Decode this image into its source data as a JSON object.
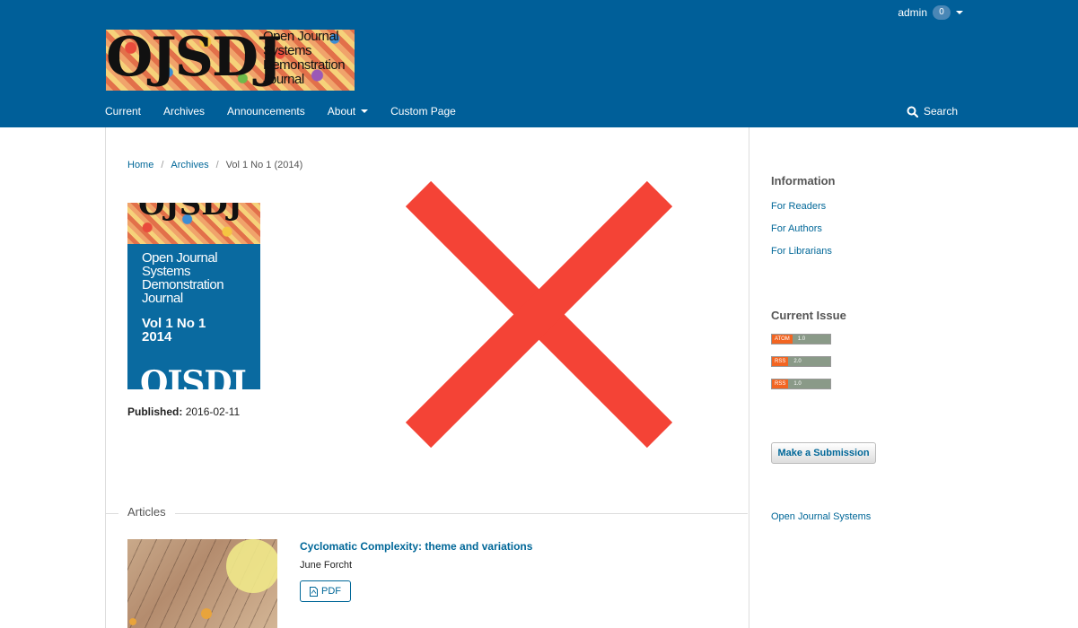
{
  "header": {
    "user": {
      "name": "admin",
      "notification_count": "0"
    },
    "logo": {
      "mark": "OJSDJ",
      "text_lines": [
        "Open Journal",
        "Systems",
        "Demonstration",
        "Journal"
      ]
    },
    "nav": {
      "items": [
        "Current",
        "Archives",
        "Announcements",
        "About",
        "Custom Page"
      ],
      "search_label": "Search"
    }
  },
  "breadcrumb": {
    "home": "Home",
    "archives": "Archives",
    "current": "Vol 1 No 1 (2014)"
  },
  "issue": {
    "cover": {
      "top_mark": "OJSDJ",
      "title_lines": [
        "Open Journal",
        "Systems",
        "Demonstration",
        "Journal"
      ],
      "vol_lines": [
        "Vol 1 No 1",
        "2014"
      ],
      "bottom_mark": "OJSDJ"
    },
    "published_label": "Published:",
    "published_date": "2016-02-11"
  },
  "articles": {
    "section_label": "Articles",
    "items": [
      {
        "title": "Cyclomatic Complexity: theme and variations",
        "author": "June Forcht",
        "galley_label": "PDF"
      }
    ]
  },
  "sidebar": {
    "information_heading": "Information",
    "information_links": [
      "For Readers",
      "For Authors",
      "For Librarians"
    ],
    "current_issue_heading": "Current Issue",
    "feeds": [
      {
        "type": "ATOM",
        "version": "1.0"
      },
      {
        "type": "RSS",
        "version": "2.0"
      },
      {
        "type": "RSS",
        "version": "1.0"
      }
    ],
    "submission_button": "Make a Submission",
    "footer_link": "Open Journal Systems"
  },
  "colors": {
    "header_bg": "#005f99",
    "link": "#006798",
    "overlay_x": "#f44336"
  }
}
